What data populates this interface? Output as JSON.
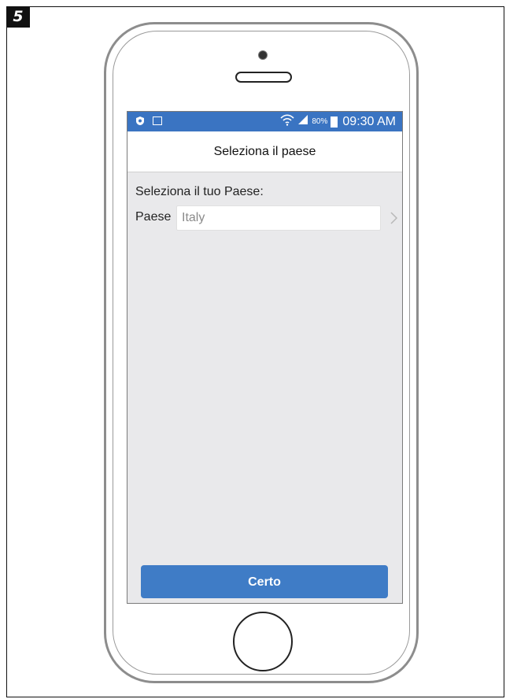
{
  "step": {
    "number": "5"
  },
  "status_bar": {
    "battery": "80%",
    "time": "09:30 AM"
  },
  "header": {
    "title": "Seleziona il paese"
  },
  "form": {
    "section_label": "Seleziona il tuo Paese:",
    "country_label": "Paese",
    "country_value": "Italy"
  },
  "actions": {
    "confirm_label": "Certo"
  },
  "colors": {
    "status_bar": "#3a74c2",
    "button": "#3f7cc6",
    "screen_background": "#e9e9eb"
  }
}
